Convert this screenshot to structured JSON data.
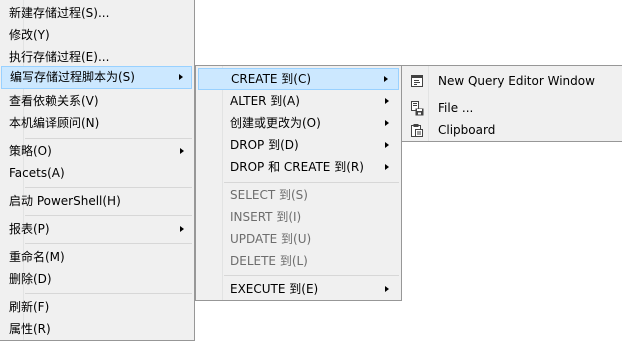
{
  "context_menu": {
    "items": [
      {
        "label": "新建存储过程(S)..."
      },
      {
        "label": "修改(Y)"
      },
      {
        "label": "执行存储过程(E)..."
      },
      {
        "label": "编写存储过程脚本为(S)"
      },
      {
        "label": "查看依赖关系(V)"
      },
      {
        "label": "本机编译顾问(N)"
      },
      {
        "label": "策略(O)"
      },
      {
        "label": "Facets(A)"
      },
      {
        "label": "启动 PowerShell(H)"
      },
      {
        "label": "报表(P)"
      },
      {
        "label": "重命名(M)"
      },
      {
        "label": "删除(D)"
      },
      {
        "label": "刷新(F)"
      },
      {
        "label": "属性(R)"
      }
    ]
  },
  "script_as_menu": {
    "items": [
      {
        "label": "CREATE 到(C)"
      },
      {
        "label": "ALTER 到(A)"
      },
      {
        "label": "创建或更改为(O)"
      },
      {
        "label": "DROP 到(D)"
      },
      {
        "label": "DROP 和 CREATE 到(R)"
      },
      {
        "label": "SELECT 到(S)"
      },
      {
        "label": "INSERT 到(I)"
      },
      {
        "label": "UPDATE 到(U)"
      },
      {
        "label": "DELETE 到(L)"
      },
      {
        "label": "EXECUTE 到(E)"
      }
    ]
  },
  "create_to_menu": {
    "items": [
      {
        "label": "New Query Editor Window",
        "icon": "query-window-icon"
      },
      {
        "label": "File ...",
        "icon": "save-file-icon"
      },
      {
        "label": "Clipboard",
        "icon": "clipboard-icon"
      }
    ]
  },
  "colors": {
    "menu_background": "#f0f0f0",
    "menu_border": "#979797",
    "highlight_background": "#cce8ff",
    "highlight_border": "#99d1ff",
    "disabled_text": "#6d6d6d"
  }
}
